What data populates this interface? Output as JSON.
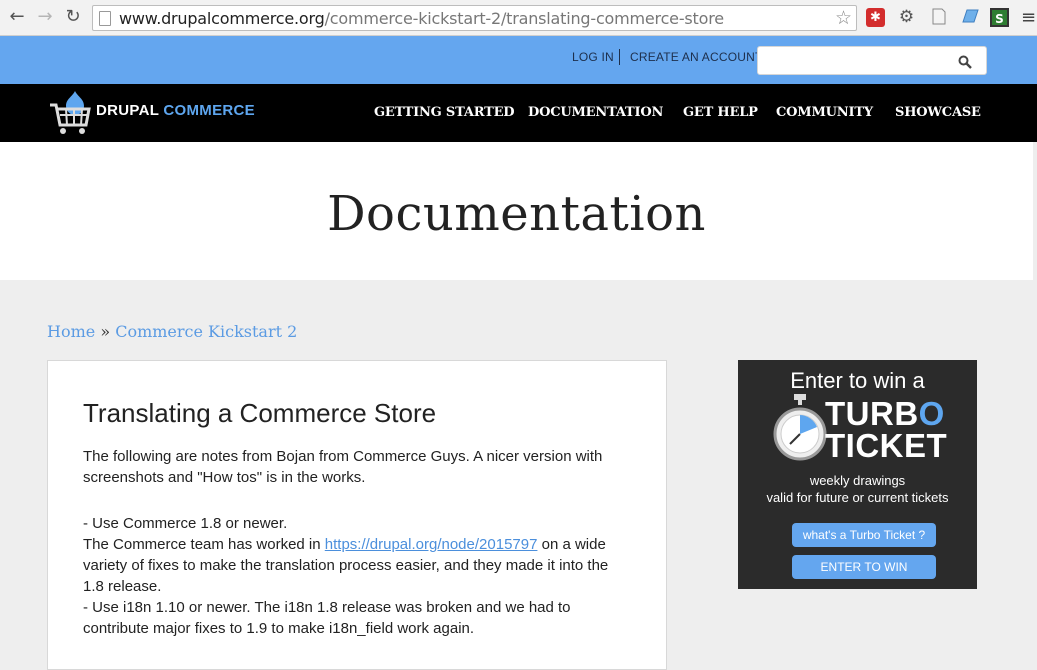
{
  "browser": {
    "back_icon": "←",
    "forward_icon": "→",
    "reload_icon": "↻",
    "url_host": "www.drupalcommerce.org",
    "url_path": "/commerce-kickstart-2/translating-commerce-store",
    "star_icon": "☆",
    "menu_icon": "≡"
  },
  "topbar": {
    "login": "LOG IN",
    "create_account": "CREATE AN ACCOUNT",
    "search_placeholder": "",
    "search_icon": "⚲"
  },
  "logo": {
    "word1": "DRUPAL",
    "word2": "COMMERCE"
  },
  "nav": [
    {
      "label": "GETTING STARTED"
    },
    {
      "label": "DOCUMENTATION"
    },
    {
      "label": "GET HELP"
    },
    {
      "label": "COMMUNITY"
    },
    {
      "label": "SHOWCASE"
    }
  ],
  "hero": {
    "title": "Documentation"
  },
  "breadcrumb": {
    "home": "Home",
    "sep": " » ",
    "section": "Commerce Kickstart 2"
  },
  "article": {
    "title": "Translating a Commerce Store",
    "intro": "The following are notes from Bojan from Commerce Guys. A nicer version with screenshots and \"How tos\" is in the works.",
    "item1_a": "- Use Commerce 1.8 or newer.",
    "item1_b_pre": "The Commerce team has worked in ",
    "item1_link": "https://drupal.org/node/2015797",
    "item1_b_post": " on a wide variety of fixes to make the translation process easier, and they made it into the 1.8 release.",
    "item2": "- Use i18n 1.10 or newer. The i18n 1.8 release was broken and we had to contribute major fixes to 1.9 to make i18n_field work again."
  },
  "ad": {
    "enter": "Enter to win a",
    "turbo_a": "TURB",
    "turbo_b": "O",
    "ticket": "TICKET",
    "line1": "weekly drawings",
    "line2": "valid for future or current tickets",
    "btn_what": "what's a Turbo Ticket ?",
    "btn_enter": "ENTER TO WIN"
  },
  "colors": {
    "accent": "#64a6ef",
    "nav_bg": "#000000",
    "ad_bg": "#2b2b2b"
  }
}
